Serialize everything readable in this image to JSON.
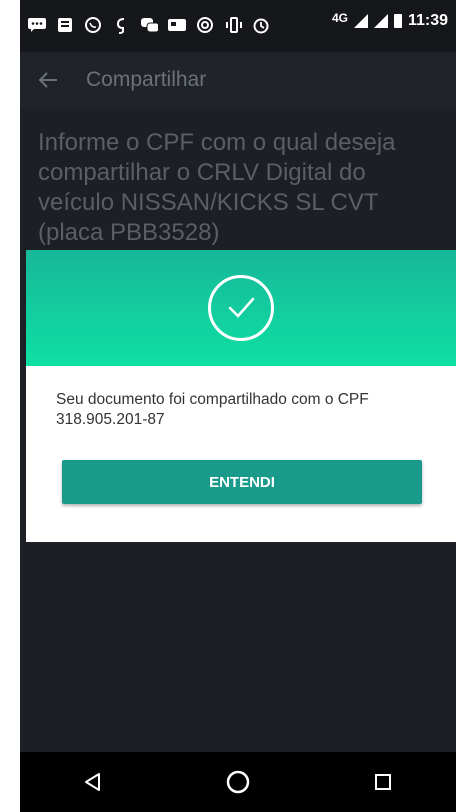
{
  "status_bar": {
    "time": "11:39",
    "network": "4G",
    "icons": [
      "message-icon",
      "news-icon",
      "whatsapp-icon",
      "g-icon",
      "chat-icon",
      "card-icon",
      "nfc-icon",
      "vibrate-icon",
      "alarm-icon",
      "signal-icon",
      "signal-icon",
      "battery-icon"
    ]
  },
  "app_bar": {
    "title": "Compartilhar",
    "back_icon": "arrow-left-icon"
  },
  "main": {
    "intro_text": "Informe o CPF com o qual deseja compartilhar o CRLV Digital do veículo NISSAN/KICKS SL CVT (placa PBB3528)"
  },
  "dialog": {
    "icon": "check-circle-icon",
    "message": "Seu documento foi compartilhado com o CPF 318.905.201-87",
    "button_label": "ENTENDI",
    "colors": {
      "header_top": "#17b79a",
      "header_bottom": "#0fe0a2",
      "button": "#1a9a8b"
    }
  },
  "nav_bar": {
    "back": "triangle-back-icon",
    "home": "circle-home-icon",
    "recents": "square-recents-icon"
  }
}
